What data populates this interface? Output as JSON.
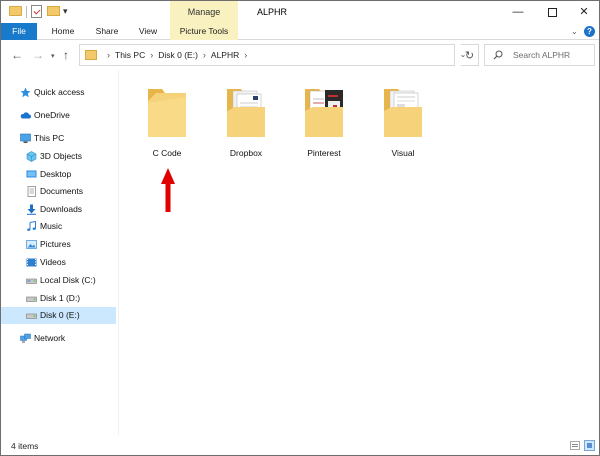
{
  "window": {
    "title": "ALPHR",
    "contextual_group_label": "Manage"
  },
  "title_buttons": {
    "minimize": "—",
    "maximize": "",
    "close": "✕"
  },
  "ribbon": {
    "tabs": [
      {
        "label": "File"
      },
      {
        "label": "Home"
      },
      {
        "label": "Share"
      },
      {
        "label": "View"
      },
      {
        "label": "Picture Tools"
      }
    ]
  },
  "address_bar": {
    "crumbs": [
      "This PC",
      "Disk 0 (E:)",
      "ALPHR"
    ]
  },
  "search": {
    "placeholder": "Search ALPHR"
  },
  "nav_pane": {
    "items": [
      {
        "label": "Quick access",
        "icon": "star-icon",
        "selected": false
      },
      {
        "label": "OneDrive",
        "icon": "cloud-icon",
        "selected": false
      },
      {
        "label": "This PC",
        "icon": "computer-icon",
        "selected": false
      },
      {
        "label": "3D Objects",
        "icon": "cube-icon",
        "selected": false
      },
      {
        "label": "Desktop",
        "icon": "desktop-icon",
        "selected": false
      },
      {
        "label": "Documents",
        "icon": "documents-icon",
        "selected": false
      },
      {
        "label": "Downloads",
        "icon": "download-icon",
        "selected": false
      },
      {
        "label": "Music",
        "icon": "music-icon",
        "selected": false
      },
      {
        "label": "Pictures",
        "icon": "pictures-icon",
        "selected": false
      },
      {
        "label": "Videos",
        "icon": "videos-icon",
        "selected": false
      },
      {
        "label": "Local Disk (C:)",
        "icon": "drive-icon",
        "selected": false
      },
      {
        "label": "Disk 1 (D:)",
        "icon": "drive-icon",
        "selected": false
      },
      {
        "label": "Disk 0 (E:)",
        "icon": "drive-icon",
        "selected": true
      },
      {
        "label": "Network",
        "icon": "network-icon",
        "selected": false
      }
    ]
  },
  "folders": [
    {
      "name": "C Code",
      "thumbnail": "empty"
    },
    {
      "name": "Dropbox",
      "thumbnail": "documents"
    },
    {
      "name": "Pinterest",
      "thumbnail": "dark-documents"
    },
    {
      "name": "Visual",
      "thumbnail": "documents"
    }
  ],
  "status": {
    "item_count": "4 items"
  },
  "colors": {
    "file_tab": "#1979ca",
    "contextual_tab": "#f9f1bf",
    "folder": "#f2c96b",
    "selection": "#cce8ff",
    "annotation_arrow": "#e00000"
  }
}
